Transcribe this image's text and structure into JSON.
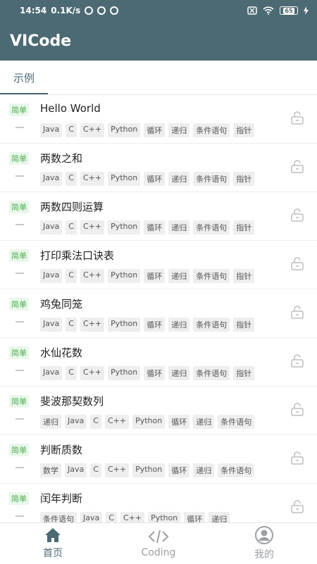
{
  "status_bar": {
    "time": "14:54",
    "speed": "0.1K/s",
    "battery": "65"
  },
  "app": {
    "title": "VICode"
  },
  "tabs": [
    {
      "label": "示例",
      "active": true
    }
  ],
  "examples": [
    {
      "difficulty": "简单",
      "title": "Hello World",
      "tags": [
        "Java",
        "C",
        "C++",
        "Python",
        "循环",
        "递归",
        "条件语句",
        "指针"
      ]
    },
    {
      "difficulty": "简单",
      "title": "两数之和",
      "tags": [
        "Java",
        "C",
        "C++",
        "Python",
        "循环",
        "递归",
        "条件语句",
        "指针"
      ]
    },
    {
      "difficulty": "简单",
      "title": "两数四则运算",
      "tags": [
        "Java",
        "C",
        "C++",
        "Python",
        "循环",
        "递归",
        "条件语句",
        "指针"
      ]
    },
    {
      "difficulty": "简单",
      "title": "打印乘法口诀表",
      "tags": [
        "Java",
        "C",
        "C++",
        "Python",
        "循环",
        "递归",
        "条件语句",
        "指针"
      ]
    },
    {
      "difficulty": "简单",
      "title": "鸡兔同笼",
      "tags": [
        "Java",
        "C",
        "C++",
        "Python",
        "循环",
        "递归",
        "条件语句",
        "指针"
      ]
    },
    {
      "difficulty": "简单",
      "title": "水仙花数",
      "tags": [
        "Java",
        "C",
        "C++",
        "Python",
        "循环",
        "递归",
        "条件语句",
        "指针"
      ]
    },
    {
      "difficulty": "简单",
      "title": "斐波那契数列",
      "tags": [
        "递归",
        "Java",
        "C",
        "C++",
        "Python",
        "循环",
        "递归",
        "条件语句"
      ]
    },
    {
      "difficulty": "简单",
      "title": "判断质数",
      "tags": [
        "数学",
        "Java",
        "C",
        "C++",
        "Python",
        "循环",
        "递归",
        "条件语句"
      ]
    },
    {
      "difficulty": "简单",
      "title": "闰年判断",
      "tags": [
        "条件语句",
        "Java",
        "C",
        "C++",
        "Python",
        "循环",
        "递归"
      ]
    }
  ],
  "bottom_nav": [
    {
      "label": "首页",
      "icon": "home-icon",
      "active": true
    },
    {
      "label": "Coding",
      "icon": "code-icon",
      "active": false
    },
    {
      "label": "我的",
      "icon": "profile-icon",
      "active": false
    }
  ],
  "colors": {
    "primary": "#4c6a73",
    "easy": "#4caf50"
  }
}
